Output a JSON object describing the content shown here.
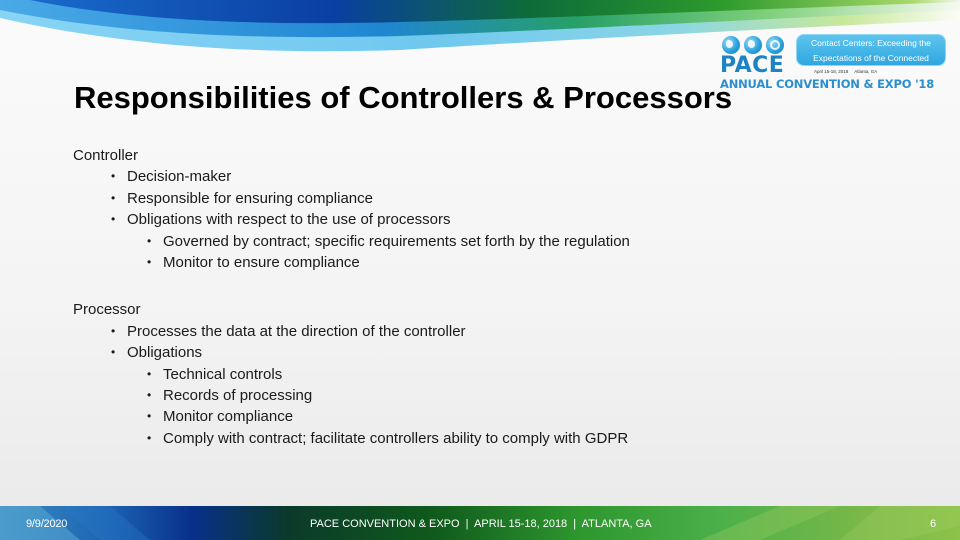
{
  "slide": {
    "title": "Responsibilities of Controllers & Processors",
    "logo": {
      "icons": [
        "globe-phone-icon",
        "globe-info-icon",
        "at-sign-icon"
      ],
      "brand": "PACE",
      "tagline_line1": "Contact Centers: Exceeding the",
      "tagline_line2": "Expectations of the Connected Customer.",
      "dateline": "April 15-18, 2018     Atlanta, GA",
      "event": "ANNUAL CONVENTION & EXPO '18"
    },
    "sections": [
      {
        "heading": "Controller",
        "items": [
          {
            "text": "Decision-maker",
            "level": 1
          },
          {
            "text": "Responsible for ensuring compliance",
            "level": 1
          },
          {
            "text": "Obligations with respect to the use of processors",
            "level": 1
          },
          {
            "text": "Governed by contract; specific requirements set forth by the regulation",
            "level": 2
          },
          {
            "text": "Monitor to ensure compliance",
            "level": 2
          }
        ]
      },
      {
        "heading": "Processor",
        "items": [
          {
            "text": "Processes the data at the direction of the controller",
            "level": 1
          },
          {
            "text": "Obligations",
            "level": 1
          },
          {
            "text": "Technical controls",
            "level": 2
          },
          {
            "text": "Records of processing",
            "level": 2
          },
          {
            "text": "Monitor compliance",
            "level": 2
          },
          {
            "text": "Comply with contract; facilitate controllers ability to comply with GDPR",
            "level": 2
          }
        ]
      }
    ],
    "bullet": "•",
    "footer": {
      "date": "9/9/2020",
      "center": "PACE CONVENTION & EXPO  |  APRIL 15-18, 2018  |  ATLANTA, GA",
      "page_number": "6"
    },
    "colors": {
      "brand_blue": "#1d83c5",
      "brand_green": "#3aa33a",
      "title": "#000000",
      "body_text": "#1a1a1a"
    }
  }
}
